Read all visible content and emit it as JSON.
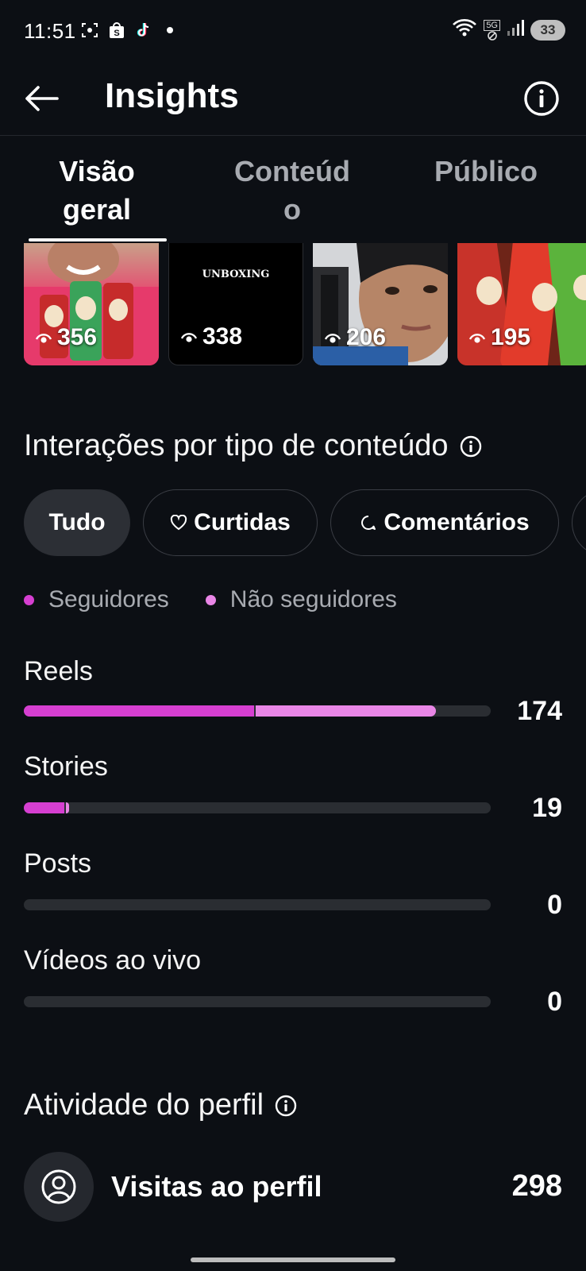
{
  "status_bar": {
    "time": "11:51",
    "network": "5G",
    "battery": "33"
  },
  "header": {
    "title": "Insights"
  },
  "tabs": [
    {
      "label_line1": "Visão",
      "label_line2": "geral"
    },
    {
      "label_line1": "Conteúd",
      "label_line2": "o"
    },
    {
      "label_line1": "Público",
      "label_line2": ""
    }
  ],
  "thumbnails": [
    {
      "views": "356"
    },
    {
      "views": "338",
      "caption": "UNBOXING"
    },
    {
      "views": "206"
    },
    {
      "views": "195"
    }
  ],
  "interactions": {
    "title": "Interações por tipo de conteúdo",
    "filters": [
      "Tudo",
      "Curtidas",
      "Comentários"
    ],
    "legend": [
      {
        "label": "Seguidores",
        "color": "#d63fd1"
      },
      {
        "label": "Não seguidores",
        "color": "#e986e6"
      }
    ]
  },
  "chart_data": {
    "type": "bar",
    "orientation": "horizontal",
    "stacked": true,
    "categories": [
      "Reels",
      "Stories",
      "Posts",
      "Vídeos ao vivo"
    ],
    "series": [
      {
        "name": "Seguidores",
        "values": [
          97,
          17,
          0,
          0
        ],
        "color": "#d63fd1"
      },
      {
        "name": "Não seguidores",
        "values": [
          77,
          2,
          0,
          0
        ],
        "color": "#e986e6"
      }
    ],
    "totals": [
      "174",
      "19",
      "0",
      "0"
    ],
    "xlim": [
      0,
      197
    ]
  },
  "profile_activity": {
    "title": "Atividade do perfil",
    "visits_label": "Visitas ao perfil",
    "visits_value": "298"
  }
}
